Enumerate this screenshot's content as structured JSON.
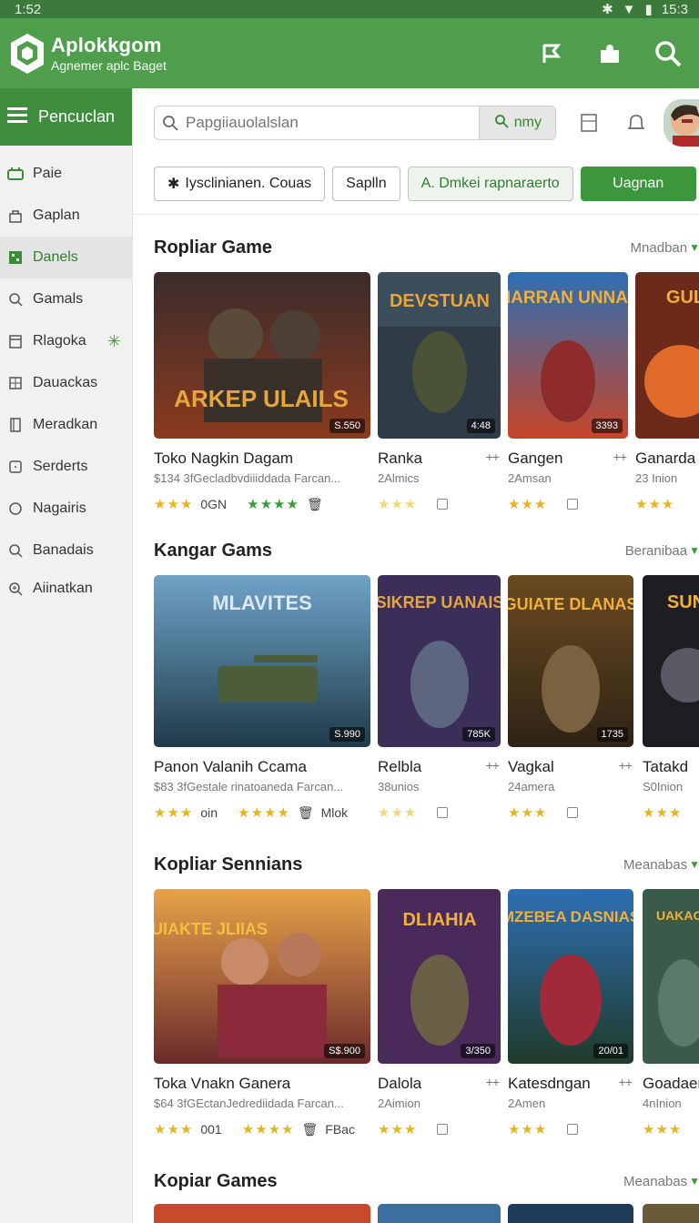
{
  "status": {
    "time": "1:52",
    "right_time": "15:3"
  },
  "app": {
    "name": "Aplokkgom",
    "tagline": "Agnemer aplc Baget"
  },
  "sidebar": {
    "header_label": "Pencuclan",
    "items": [
      {
        "label": "Paie",
        "icon": "controller-icon"
      },
      {
        "label": "Gaplan",
        "icon": "bag-icon"
      },
      {
        "label": "Danels",
        "icon": "grid-icon"
      },
      {
        "label": "Gamals",
        "icon": "search-icon"
      },
      {
        "label": "Rlagoka",
        "icon": "calendar-icon"
      },
      {
        "label": "Dauackas",
        "icon": "grid-icon"
      },
      {
        "label": "Meradkan",
        "icon": "book-icon"
      },
      {
        "label": "Serderts",
        "icon": "square-icon"
      },
      {
        "label": "Nagairis",
        "icon": "circle-icon"
      },
      {
        "label": "Banadais",
        "icon": "search-icon"
      },
      {
        "label": "Aiinatkan",
        "icon": "zoom-icon"
      }
    ]
  },
  "search": {
    "placeholder": "Papgiiauolalslan",
    "button_label": "nmy"
  },
  "filters": {
    "chip1": "Iysclinianen. Couas",
    "chip2": "Saplln",
    "chip3": "A. Dmkei rapnaraerto",
    "primary": "Uagnan"
  },
  "sections": [
    {
      "title": "Ropliar Game",
      "more": "Mnadban",
      "cards": [
        {
          "title": "Toko Nagkin Dagam",
          "sub": "$134 3fGecladbvdiiiddada Farcan...",
          "price": "S.550",
          "meta1": "0GN",
          "art": "ARKEP ULAILS"
        },
        {
          "title": "Ranka",
          "sub": "2Almics",
          "price": "4:48",
          "art": "DEVSTUAN"
        },
        {
          "title": "Gangen",
          "sub": "2Amsan",
          "price": "3393",
          "art": "MARRAN UNNAS"
        },
        {
          "title": "Ganarda",
          "sub": "23 Inion",
          "price": "",
          "art": "GUL"
        }
      ]
    },
    {
      "title": "Kangar Gams",
      "more": "Beranibaa",
      "cards": [
        {
          "title": "Panon Valanih Ccama",
          "sub": "$83 3fGestale rinatoaneda Farcan...",
          "price": "S.990",
          "meta1": "oin",
          "meta2": "Mlok",
          "art": "MLAVITES"
        },
        {
          "title": "Relbla",
          "sub": "38unios",
          "price": "785K",
          "art": "SIKREP UANAIS"
        },
        {
          "title": "Vagkal",
          "sub": "24amera",
          "price": "1735",
          "art": "GUIATE DLANAS"
        },
        {
          "title": "Tatakd",
          "sub": "S0Inion",
          "price": "",
          "art": "SUN"
        }
      ]
    },
    {
      "title": "Kopliar Sennians",
      "more": "Meanabas",
      "cards": [
        {
          "title": "Toka Vnakn Ganera",
          "sub": "$64 3fGEctanJedrediidada Farcan...",
          "price": "S$.900",
          "meta1": "001",
          "meta2": "FBac",
          "art": "GUIAKTE JLIIAS"
        },
        {
          "title": "Dalola",
          "sub": "2Aimion",
          "price": "3/350",
          "art": "DLIAHIA"
        },
        {
          "title": "Katesdngan",
          "sub": "2Amen",
          "price": "20/01",
          "art": "MZEBEA DASNIAS"
        },
        {
          "title": "Goadaer",
          "sub": "4nInion",
          "price": "",
          "art": "UAKAOT"
        }
      ]
    },
    {
      "title": "Kopiar Games",
      "more": "Meanabas"
    }
  ]
}
